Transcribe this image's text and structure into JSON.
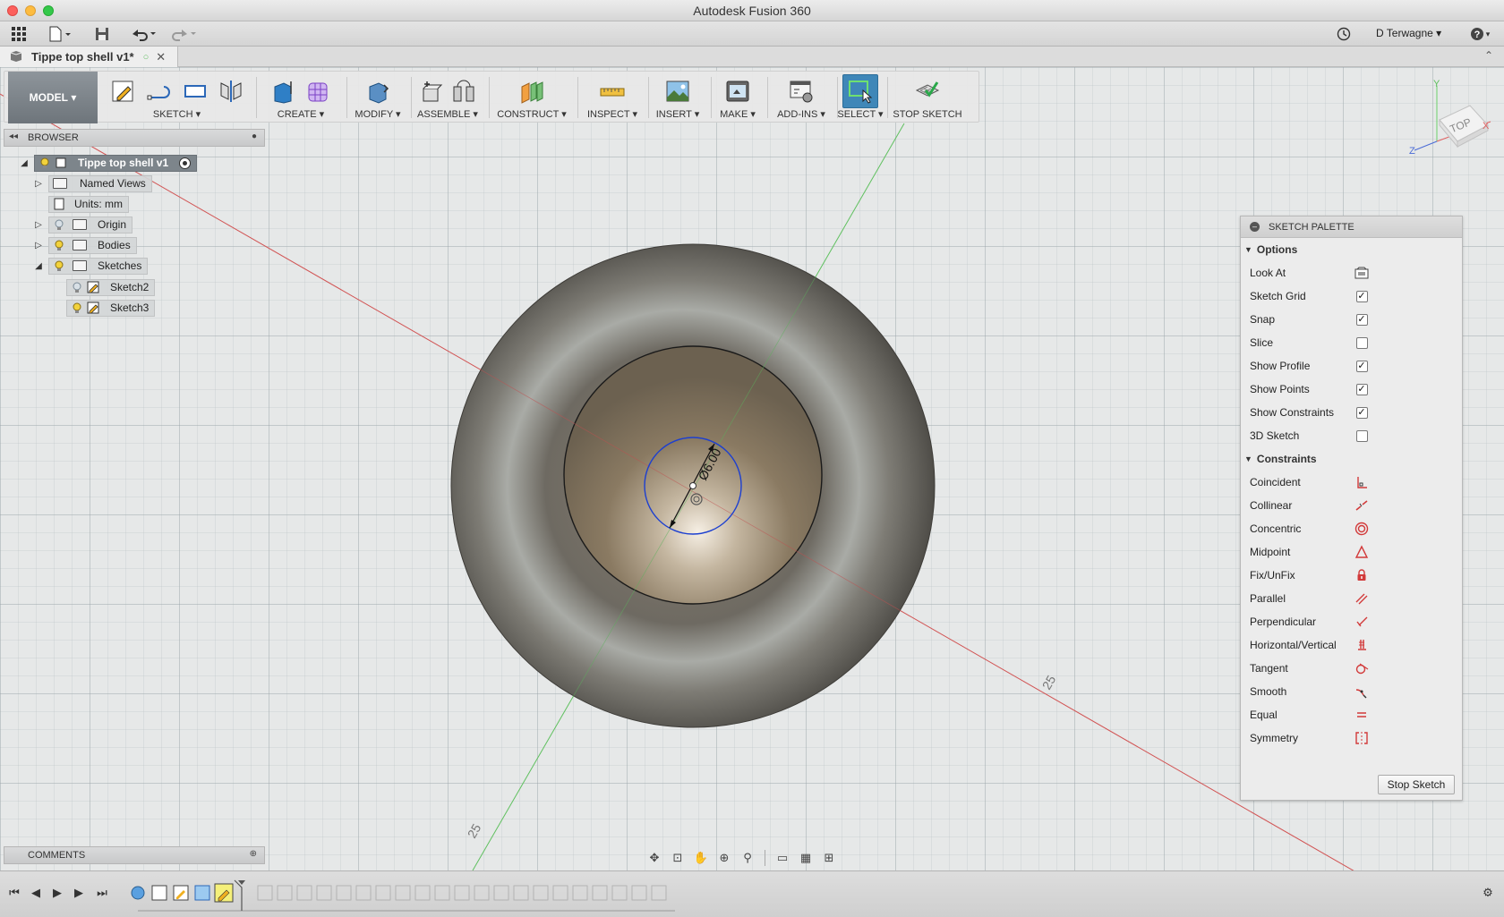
{
  "window": {
    "title": "Autodesk Fusion 360"
  },
  "quick_access": {
    "user": "D Terwagne",
    "help": "?"
  },
  "document_tab": {
    "title": "Tippe top shell v1*"
  },
  "ribbon": {
    "workspace": "MODEL",
    "groups": [
      {
        "label": "SKETCH"
      },
      {
        "label": "CREATE"
      },
      {
        "label": "MODIFY"
      },
      {
        "label": "ASSEMBLE"
      },
      {
        "label": "CONSTRUCT"
      },
      {
        "label": "INSPECT"
      },
      {
        "label": "INSERT"
      },
      {
        "label": "MAKE"
      },
      {
        "label": "ADD-INS"
      },
      {
        "label": "SELECT"
      },
      {
        "label": "STOP SKETCH"
      }
    ]
  },
  "browser": {
    "title": "BROWSER",
    "root": "Tippe top shell v1",
    "items": [
      {
        "label": "Named Views"
      },
      {
        "label": "Units: mm"
      },
      {
        "label": "Origin"
      },
      {
        "label": "Bodies"
      },
      {
        "label": "Sketches"
      },
      {
        "label": "Sketch2"
      },
      {
        "label": "Sketch3"
      }
    ]
  },
  "comments": {
    "title": "COMMENTS"
  },
  "viewport": {
    "dimension_text": "Ø6.00",
    "axis_tick_label_1": "25",
    "axis_tick_label_2": "25"
  },
  "viewcube": {
    "face": "TOP",
    "axis_x": "X",
    "axis_y": "Y",
    "axis_z": "Z"
  },
  "sketch_palette": {
    "title": "SKETCH PALETTE",
    "options_header": "Options",
    "options": [
      {
        "label": "Look At",
        "type": "button"
      },
      {
        "label": "Sketch Grid",
        "checked": true
      },
      {
        "label": "Snap",
        "checked": true
      },
      {
        "label": "Slice",
        "checked": false
      },
      {
        "label": "Show Profile",
        "checked": true
      },
      {
        "label": "Show Points",
        "checked": true
      },
      {
        "label": "Show Constraints",
        "checked": true
      },
      {
        "label": "3D Sketch",
        "checked": false
      }
    ],
    "constraints_header": "Constraints",
    "constraints": [
      {
        "label": "Coincident",
        "icon": "coincident-icon"
      },
      {
        "label": "Collinear",
        "icon": "collinear-icon"
      },
      {
        "label": "Concentric",
        "icon": "concentric-icon"
      },
      {
        "label": "Midpoint",
        "icon": "midpoint-icon"
      },
      {
        "label": "Fix/UnFix",
        "icon": "lock-icon"
      },
      {
        "label": "Parallel",
        "icon": "parallel-icon"
      },
      {
        "label": "Perpendicular",
        "icon": "perpendicular-icon"
      },
      {
        "label": "Horizontal/Vertical",
        "icon": "horizontal-vertical-icon"
      },
      {
        "label": "Tangent",
        "icon": "tangent-icon"
      },
      {
        "label": "Smooth",
        "icon": "smooth-icon"
      },
      {
        "label": "Equal",
        "icon": "equal-icon"
      },
      {
        "label": "Symmetry",
        "icon": "symmetry-icon"
      }
    ],
    "stop_button": "Stop Sketch"
  },
  "colors": {
    "select_active": "#3f87b8",
    "x_axis": "#e06060",
    "y_axis": "#6cd06c",
    "constraint_red": "#d23a3a",
    "sketch_blue": "#1c3fd0"
  }
}
